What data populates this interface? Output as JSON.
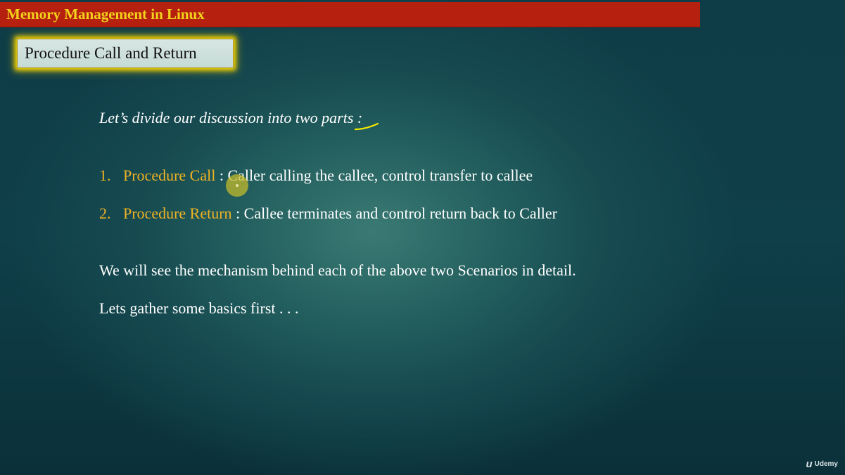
{
  "header": {
    "title": "Memory Management in Linux"
  },
  "section": {
    "title": "Procedure Call and Return"
  },
  "content": {
    "intro": "Let’s divide our discussion into two parts :",
    "items": [
      {
        "number": "1.",
        "term": "Procedure Call",
        "description": " : Caller calling the callee, control transfer to callee"
      },
      {
        "number": "2.",
        "term": "Procedure Return",
        "description": " : Callee terminates and control return back to Caller"
      }
    ],
    "lines": [
      "We will see the mechanism behind each of the above two Scenarios in detail.",
      "Lets gather some basics first . . ."
    ]
  },
  "branding": {
    "icon_glyph": "u",
    "text": "Udemy"
  },
  "colors": {
    "header_bar": "#b5200f",
    "header_text": "#f2d21c",
    "highlight_text": "#f0b323",
    "box_glow": "#f0d000",
    "cursor": "#c8be28"
  }
}
